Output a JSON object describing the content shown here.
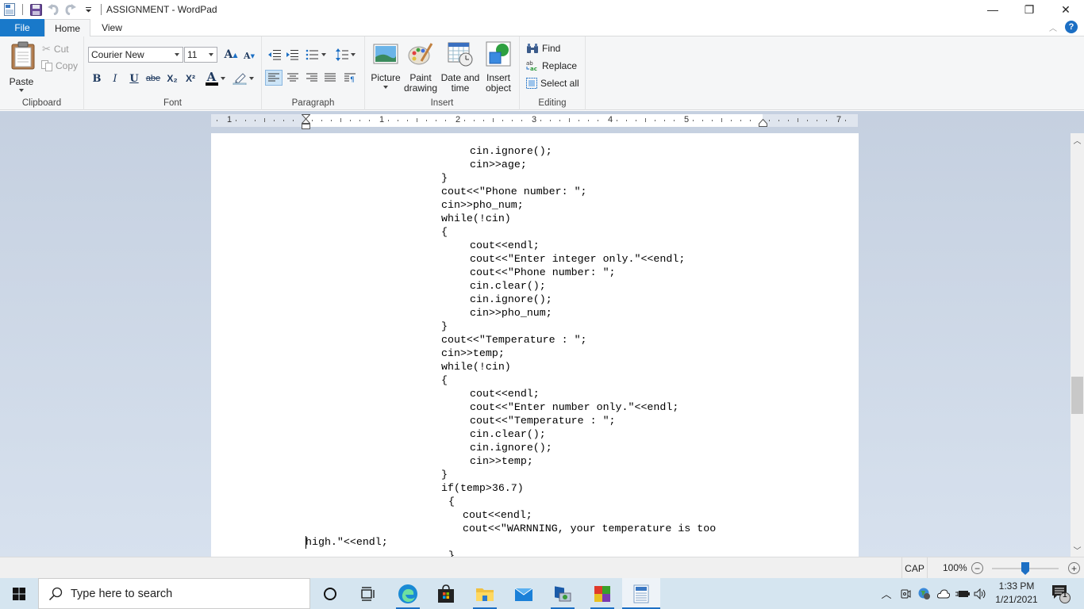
{
  "window": {
    "title": "ASSIGNMENT - WordPad",
    "controls": {
      "minimize": "—",
      "restore": "❐",
      "close": "✕"
    }
  },
  "tabs": [
    {
      "label": "File"
    },
    {
      "label": "Home"
    },
    {
      "label": "View"
    }
  ],
  "ribbon": {
    "clipboard": {
      "label": "Clipboard",
      "paste": "Paste",
      "cut": "Cut",
      "copy": "Copy"
    },
    "font": {
      "label": "Font",
      "family": "Courier New",
      "size": "11",
      "bold": "B",
      "italic": "I",
      "underline": "U",
      "strikethrough": "abe",
      "subscript": "X₂",
      "superscript": "X²",
      "grow": "A",
      "shrink": "A",
      "text_color": "A",
      "text_color_value": "#000000"
    },
    "paragraph": {
      "label": "Paragraph"
    },
    "insert": {
      "label": "Insert",
      "picture": "Picture",
      "paint_line1": "Paint",
      "paint_line2": "drawing",
      "datetime_line1": "Date and",
      "datetime_line2": "time",
      "object_line1": "Insert",
      "object_line2": "object"
    },
    "editing": {
      "label": "Editing",
      "find": "Find",
      "replace": "Replace",
      "select_all": "Select all"
    }
  },
  "ruler": {
    "labels": [
      "1",
      "1",
      "2",
      "3",
      "4",
      "5",
      "7"
    ]
  },
  "document": {
    "lines": [
      {
        "indent": 2,
        "text": "cin.ignore();"
      },
      {
        "indent": 2,
        "text": "cin>>age;"
      },
      {
        "indent": 1,
        "text": "}"
      },
      {
        "indent": 1,
        "text": "cout<<\"Phone number: \";"
      },
      {
        "indent": 1,
        "text": "cin>>pho_num;"
      },
      {
        "indent": 1,
        "text": "while(!cin)"
      },
      {
        "indent": 1,
        "text": "{"
      },
      {
        "indent": 2,
        "text": "cout<<endl;"
      },
      {
        "indent": 2,
        "text": "cout<<\"Enter integer only.\"<<endl;"
      },
      {
        "indent": 2,
        "text": "cout<<\"Phone number: \";"
      },
      {
        "indent": 2,
        "text": "cin.clear();"
      },
      {
        "indent": 2,
        "text": "cin.ignore();"
      },
      {
        "indent": 2,
        "text": "cin>>pho_num;"
      },
      {
        "indent": 1,
        "text": "}"
      },
      {
        "indent": 1,
        "text": "cout<<\"Temperature : \";"
      },
      {
        "indent": 1,
        "text": "cin>>temp;"
      },
      {
        "indent": 1,
        "text": "while(!cin)"
      },
      {
        "indent": 1,
        "text": "{"
      },
      {
        "indent": 2,
        "text": "cout<<endl;"
      },
      {
        "indent": 2,
        "text": "cout<<\"Enter number only.\"<<endl;"
      },
      {
        "indent": 2,
        "text": "cout<<\"Temperature : \";"
      },
      {
        "indent": 2,
        "text": "cin.clear();"
      },
      {
        "indent": 2,
        "text": "cin.ignore();"
      },
      {
        "indent": 2,
        "text": "cin>>temp;"
      },
      {
        "indent": 1,
        "text": "}"
      },
      {
        "indent": 1,
        "text": "if(temp>36.7)"
      },
      {
        "indent": 3,
        "text": "{"
      },
      {
        "indent": 4,
        "text": "cout<<endl;"
      },
      {
        "indent": 4,
        "text": "cout<<\"WARNNING, your temperature is too"
      },
      {
        "indent": 0,
        "text": "high.\"<<endl;"
      },
      {
        "indent": 3,
        "text": "}"
      }
    ]
  },
  "statusbar": {
    "caps": "CAP",
    "zoom": "100%",
    "zoom_out": "−",
    "zoom_in": "+",
    "zoom_level_percent": 100
  },
  "taskbar": {
    "search_placeholder": "Type here to search",
    "apps": [
      "cortana",
      "task-view",
      "edge",
      "store",
      "file-explorer",
      "mail",
      "remote-desktop",
      "office",
      "wordpad"
    ],
    "clock_time": "1:33 PM",
    "clock_date": "1/21/2021",
    "notification_count": "1"
  }
}
